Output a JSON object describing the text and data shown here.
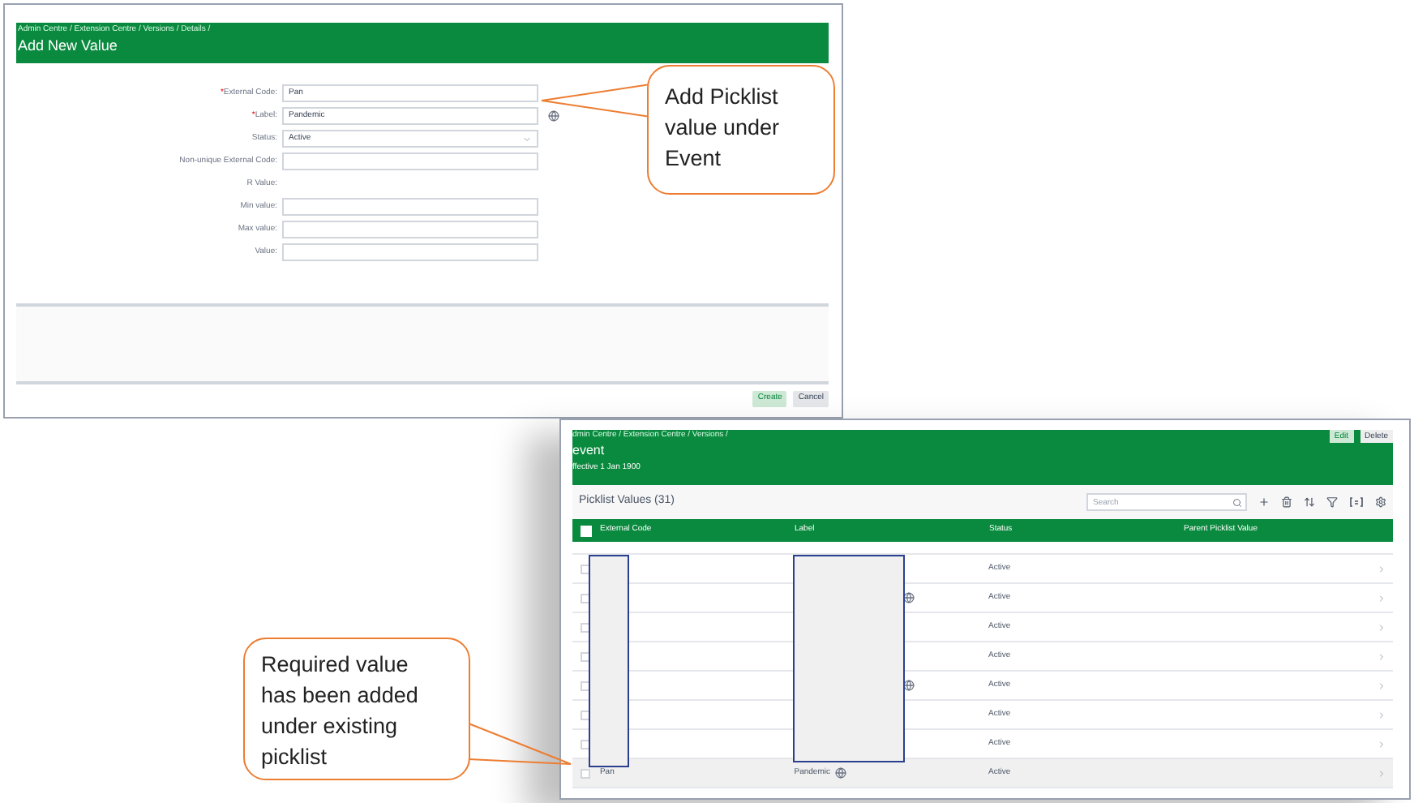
{
  "form_screenshot": {
    "breadcrumb": "Admin Centre / Extension Centre / Versions / Details /",
    "title": "Add New Value",
    "fields": [
      {
        "label": "External Code:",
        "required_mark": "*",
        "kind": "text",
        "value": "Pan"
      },
      {
        "label": "Label:",
        "required_mark": "*",
        "kind": "text",
        "value": "Pandemic",
        "translatable": true
      },
      {
        "label": "Status:",
        "kind": "select",
        "value": "Active"
      },
      {
        "label": "Non-unique External Code:",
        "kind": "text"
      },
      {
        "label": "R Value:",
        "kind": "static"
      },
      {
        "label": "Min value:",
        "kind": "text"
      },
      {
        "label": "Max value:",
        "kind": "text"
      },
      {
        "label": "Value:",
        "kind": "text"
      }
    ],
    "buttons": [
      {
        "label": "Create",
        "kind": "primary"
      },
      {
        "label": "Cancel",
        "kind": "secondary"
      }
    ]
  },
  "callouts": [
    {
      "text": "Add Picklist value under Event"
    },
    {
      "text": "Required value has been added under existing picklist"
    }
  ],
  "picklist_screenshot": {
    "breadcrumb": "dmin Centre / Extension Centre / Versions /",
    "title": "event",
    "effective": "ffective 1 Jan 1900",
    "header_buttons": [
      "Edit",
      "Delete"
    ],
    "section_title": "Picklist Values (31)",
    "select_all": {
      "checked": false
    },
    "search": {
      "placeholder": "Search"
    },
    "columns": [
      "External Code",
      "Label",
      "Status",
      "Parent Picklist Value"
    ],
    "rows": [
      {
        "status": "Active",
        "translatable": false,
        "highlighted": false
      },
      {
        "status": "Active",
        "translatable": true,
        "highlighted": false
      },
      {
        "status": "Active",
        "translatable": false,
        "highlighted": false
      },
      {
        "status": "Active",
        "translatable": false,
        "highlighted": false
      },
      {
        "status": "Active",
        "translatable": true,
        "highlighted": false
      },
      {
        "status": "Active",
        "translatable": false,
        "highlighted": false
      },
      {
        "status": "Active",
        "translatable": false,
        "highlighted": false
      },
      {
        "external_code": "Pan",
        "label": "Pandemic",
        "status": "Active",
        "translatable": true,
        "highlighted": true
      }
    ]
  }
}
